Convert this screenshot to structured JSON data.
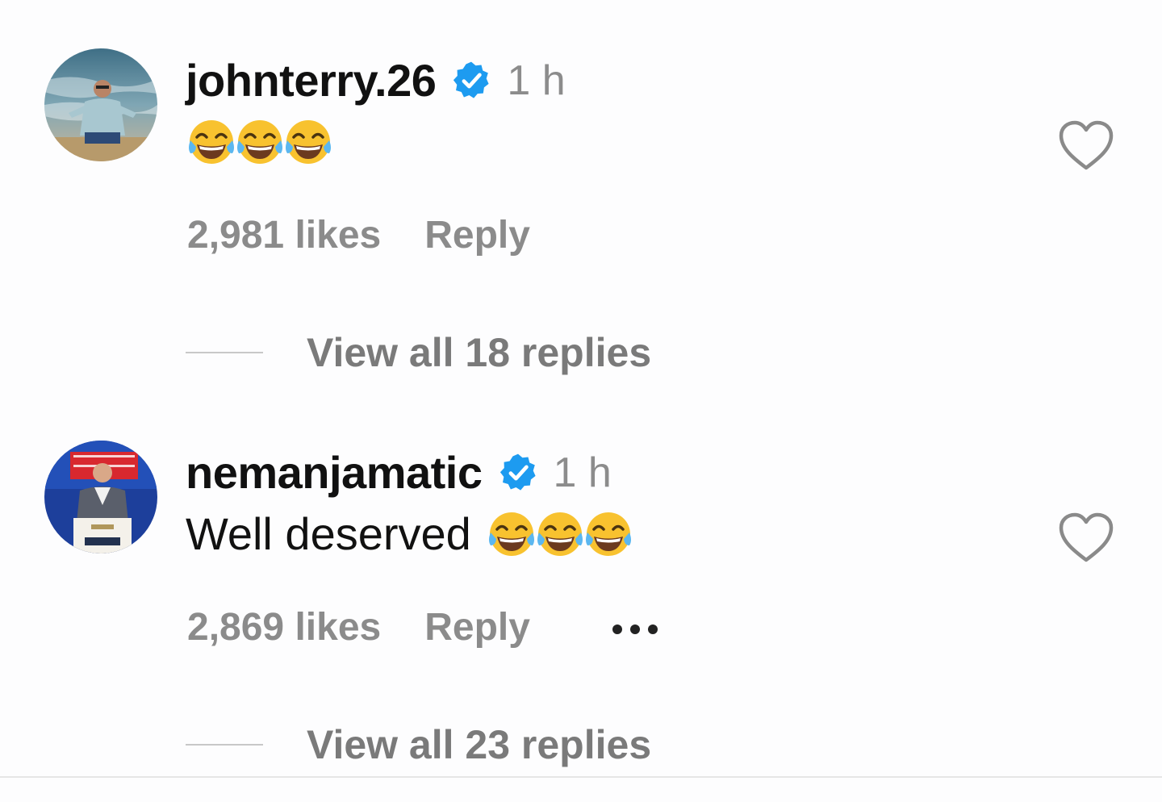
{
  "comments": [
    {
      "username": "johnterry.26",
      "time": "1 h",
      "text": "",
      "emojis": [
        "😂",
        "😂",
        "😂"
      ],
      "likes": "2,981 likes",
      "reply_label": "Reply",
      "view_replies": "View all 18 replies"
    },
    {
      "username": "nemanjamatic",
      "time": "1 h",
      "text": "Well deserved",
      "emojis": [
        "😂",
        "😂",
        "😂"
      ],
      "likes": "2,869 likes",
      "reply_label": "Reply",
      "view_replies": "View all 23 replies"
    }
  ],
  "colors": {
    "verified": "#1d9bf0",
    "muted": "#8b8b8b",
    "text": "#111111"
  }
}
